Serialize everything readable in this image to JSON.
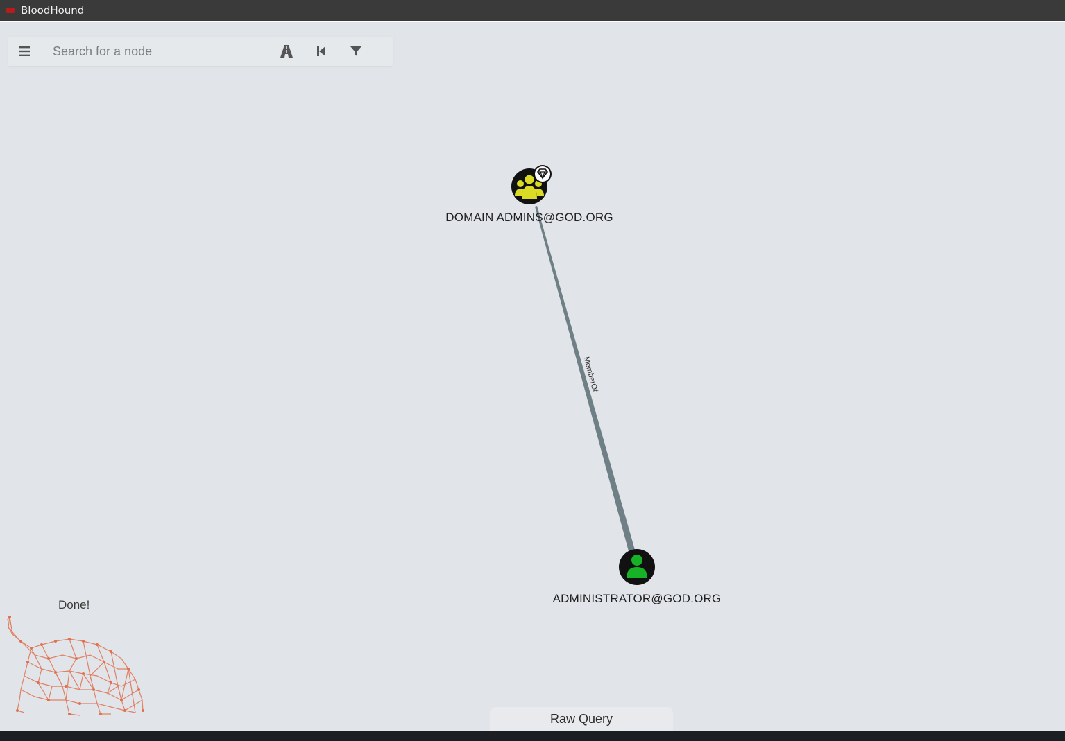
{
  "app": {
    "title": "BloodHound",
    "accent_color": "#b71c1c"
  },
  "search": {
    "placeholder": "Search for a node",
    "value": ""
  },
  "toolbar": {
    "buttons": [
      {
        "name": "pathfinding-button",
        "icon": "road-icon"
      },
      {
        "name": "back-button",
        "icon": "step-backward-icon"
      },
      {
        "name": "filter-button",
        "icon": "filter-icon"
      }
    ]
  },
  "graph": {
    "nodes": [
      {
        "id": "domain-admins",
        "label": "DOMAIN ADMINS@GOD.ORG",
        "type": "Group",
        "color": "#dbdb26",
        "highvalue": true,
        "icon": "users-icon"
      },
      {
        "id": "administrator",
        "label": "ADMINISTRATOR@GOD.ORG",
        "type": "User",
        "color": "#17b326",
        "highvalue": false,
        "icon": "user-icon"
      }
    ],
    "edges": [
      {
        "source": "administrator",
        "target": "domain-admins",
        "label": "MemberOf"
      }
    ]
  },
  "status": {
    "text": "Done!"
  },
  "raw_query": {
    "label": "Raw Query"
  }
}
